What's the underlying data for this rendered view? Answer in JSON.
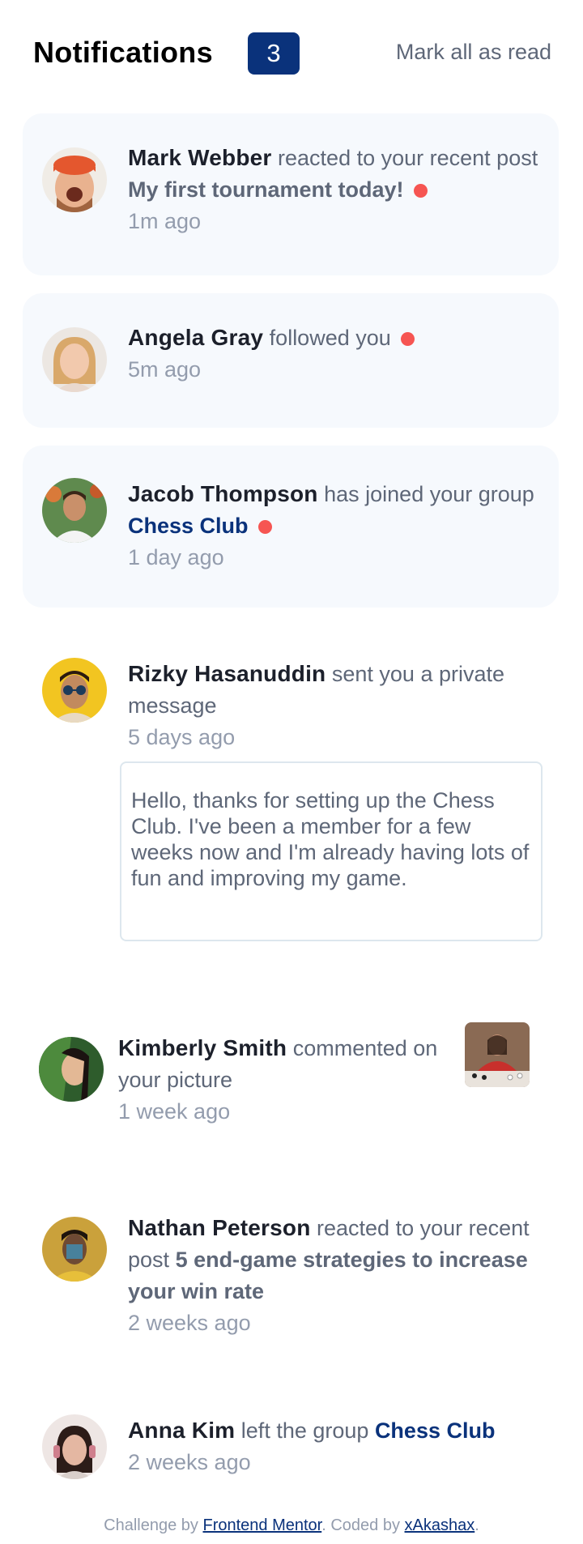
{
  "header": {
    "title": "Notifications",
    "count": "3",
    "mark_all": "Mark all as read"
  },
  "notifications": [
    {
      "name": "Mark Webber",
      "action": "reacted to your recent post",
      "post": "My first tournament today!",
      "time": "1m ago",
      "unread": true
    },
    {
      "name": "Angela Gray",
      "action": "followed you",
      "time": "5m ago",
      "unread": true
    },
    {
      "name": "Jacob Thompson",
      "action": "has joined your group",
      "group": "Chess Club",
      "time": "1 day ago",
      "unread": true
    },
    {
      "name": "Rizky Hasanuddin",
      "action": "sent you a private message",
      "time": "5 days ago",
      "unread": false,
      "message": "Hello, thanks for setting up the Chess Club. I've been a member for a few weeks now and I'm already having lots of fun and improving my game."
    },
    {
      "name": "Kimberly Smith",
      "action": "commented on your picture",
      "time": "1 week ago",
      "unread": false
    },
    {
      "name": "Nathan Peterson",
      "action": "reacted to your recent post",
      "post": "5 end-game strategies to increase your win rate",
      "time": "2 weeks ago",
      "unread": false
    },
    {
      "name": "Anna Kim",
      "action": "left the group",
      "group": "Chess Club",
      "time": "2 weeks ago",
      "unread": false
    }
  ],
  "footer": {
    "prefix": "Challenge by",
    "link1": "Frontend Mentor",
    "middle": ". Coded by",
    "link2": "xAkashax",
    "suffix": "."
  },
  "colors": {
    "accent": "#0a327b",
    "unread_bg": "#f6f9fd",
    "dot": "#f65552",
    "text": "#5e6778",
    "muted": "#939cad"
  }
}
